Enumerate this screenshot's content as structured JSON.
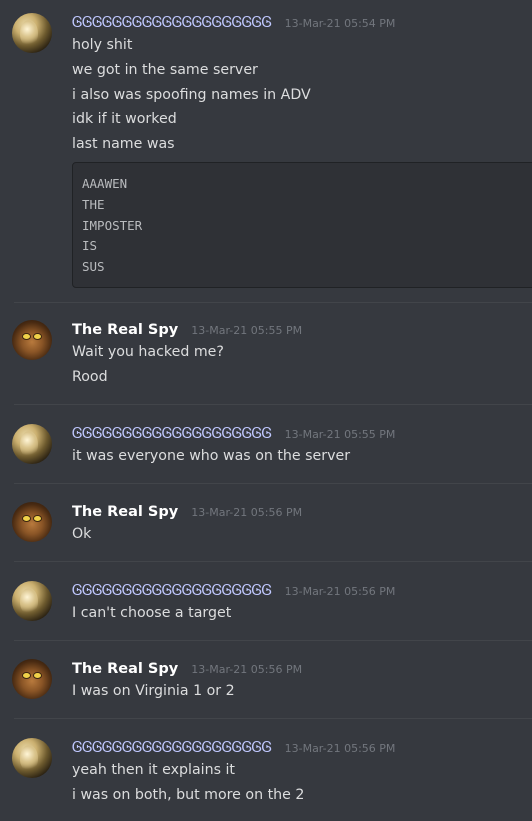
{
  "messages": [
    {
      "author": "ᎶᎶᎶᎶᎶᎶᎶᎶᎶᎶᎶᎶᎶᎶᎶᎶᎶᎶᎶᎶ",
      "timestamp": "13-Mar-21 05:54 PM",
      "avatar": "golden-statue-avatar",
      "lines": [
        "holy shit",
        "we got in the same server",
        "i also was spoofing names in ADV",
        "idk if it worked",
        "last name was"
      ],
      "code": [
        "AAAWEN",
        "THE",
        "IMPOSTER",
        "IS",
        "SUS"
      ]
    },
    {
      "author": "The Real Spy",
      "timestamp": "13-Mar-21 05:55 PM",
      "avatar": "cat-avatar",
      "lines": [
        "Wait you hacked me?",
        "Rood"
      ]
    },
    {
      "author": "ᎶᎶᎶᎶᎶᎶᎶᎶᎶᎶᎶᎶᎶᎶᎶᎶᎶᎶᎶᎶ",
      "timestamp": "13-Mar-21 05:55 PM",
      "avatar": "golden-statue-avatar",
      "lines": [
        "it was everyone who was on the server"
      ]
    },
    {
      "author": "The Real Spy",
      "timestamp": "13-Mar-21 05:56 PM",
      "avatar": "cat-avatar",
      "lines": [
        "Ok"
      ]
    },
    {
      "author": "ᎶᎶᎶᎶᎶᎶᎶᎶᎶᎶᎶᎶᎶᎶᎶᎶᎶᎶᎶᎶ",
      "timestamp": "13-Mar-21 05:56 PM",
      "avatar": "golden-statue-avatar",
      "lines": [
        "I can't choose a target"
      ]
    },
    {
      "author": "The Real Spy",
      "timestamp": "13-Mar-21 05:56 PM",
      "avatar": "cat-avatar",
      "lines": [
        "I was on Virginia 1 or 2"
      ]
    },
    {
      "author": "ᎶᎶᎶᎶᎶᎶᎶᎶᎶᎶᎶᎶᎶᎶᎶᎶᎶᎶᎶᎶ",
      "timestamp": "13-Mar-21 05:56 PM",
      "avatar": "golden-statue-avatar",
      "lines": [
        "yeah then it explains it",
        "i was on both, but more on the 2"
      ]
    }
  ]
}
